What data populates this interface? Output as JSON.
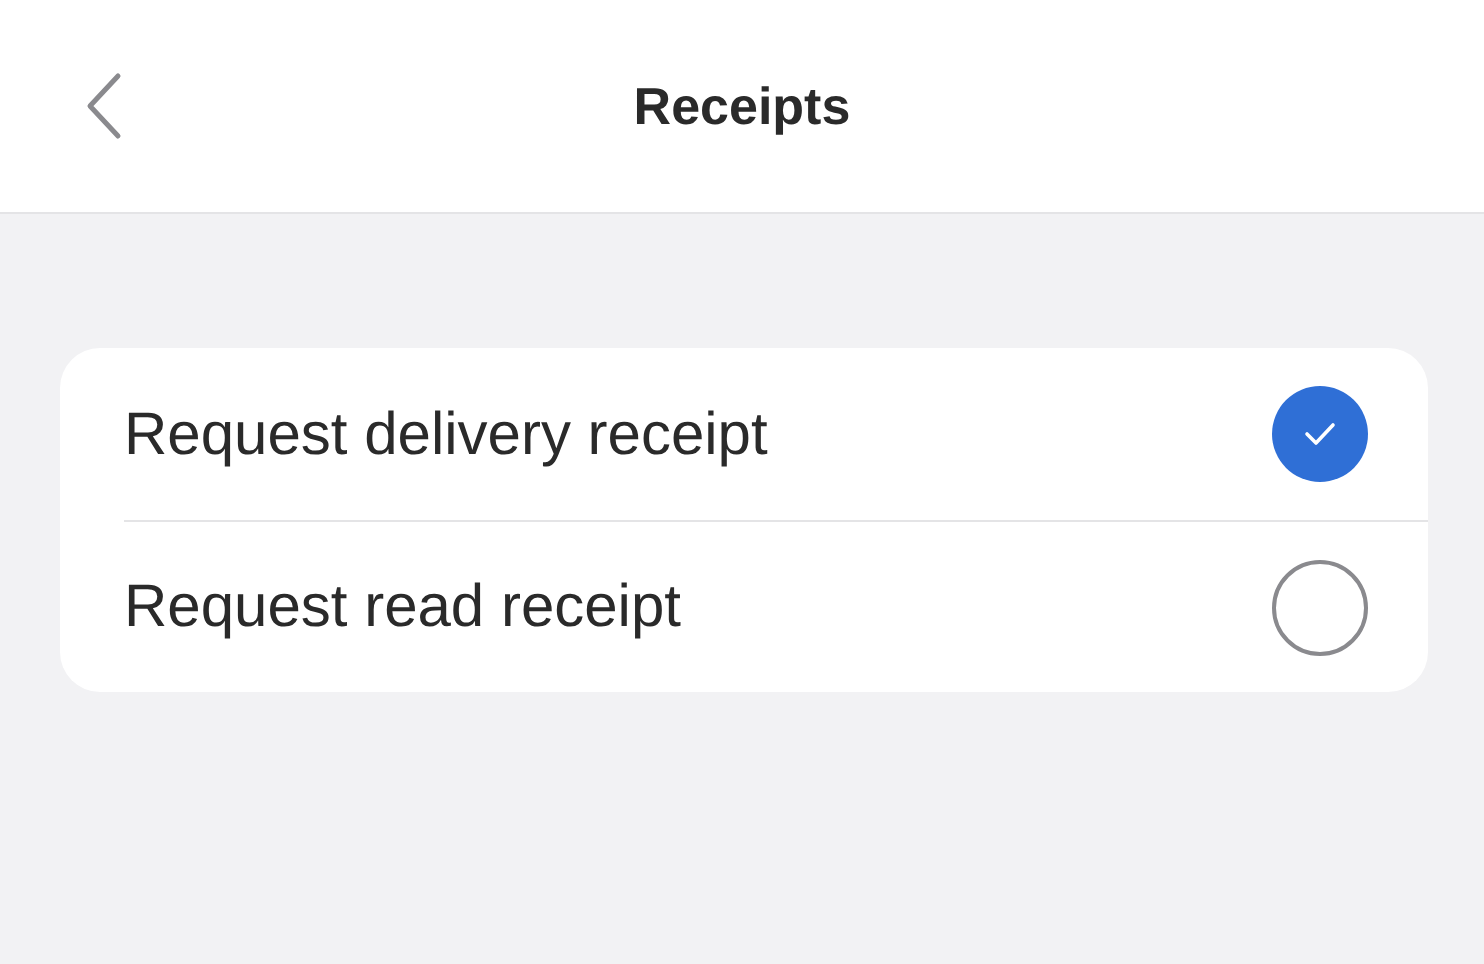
{
  "header": {
    "title": "Receipts"
  },
  "options": [
    {
      "label": "Request delivery receipt",
      "checked": true
    },
    {
      "label": "Request read receipt",
      "checked": false
    }
  ]
}
